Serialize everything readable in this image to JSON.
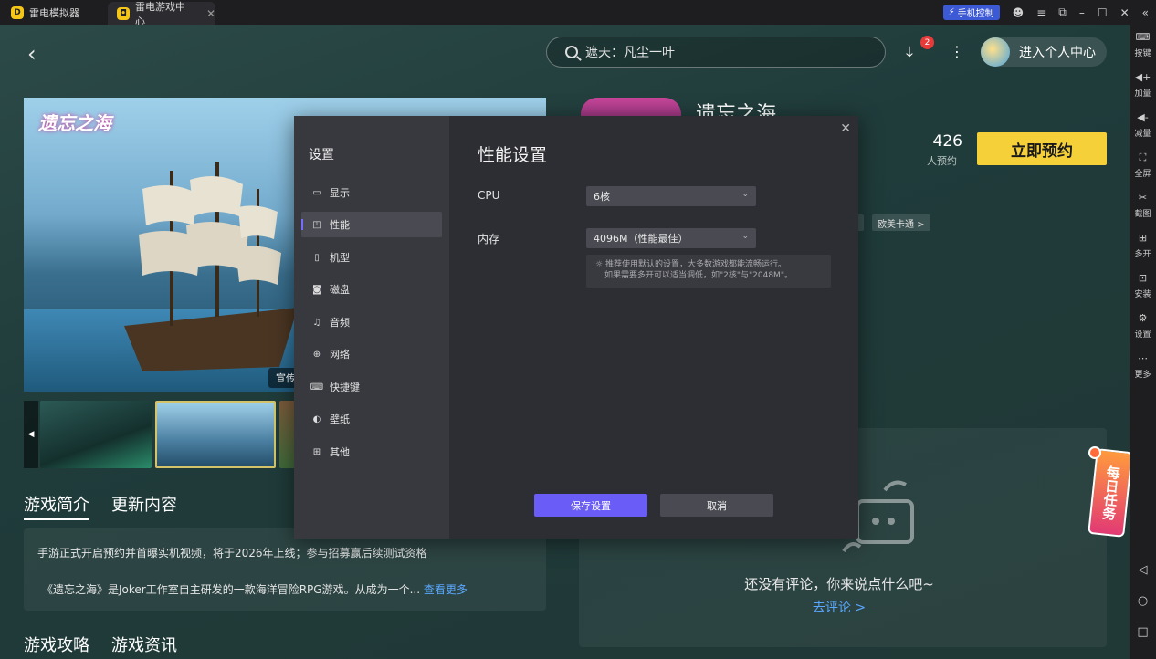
{
  "titlebar": {
    "tabs": [
      {
        "label": "雷电模拟器"
      },
      {
        "label": "雷电游戏中心"
      }
    ],
    "phone_control": "手机控制"
  },
  "sidebar": {
    "items": [
      {
        "label": "按键",
        "icon": "keyboard-icon"
      },
      {
        "label": "加量",
        "icon": "volume-up-icon"
      },
      {
        "label": "减量",
        "icon": "volume-down-icon"
      },
      {
        "label": "全屏",
        "icon": "fullscreen-icon"
      },
      {
        "label": "截图",
        "icon": "scissors-icon"
      },
      {
        "label": "多开",
        "icon": "multi-instance-icon"
      },
      {
        "label": "安装",
        "icon": "install-icon"
      },
      {
        "label": "设置",
        "icon": "gear-icon"
      },
      {
        "label": "更多",
        "icon": "more-icon"
      }
    ]
  },
  "header": {
    "search_text": "遮天：凡尘一叶",
    "download_badge": "2",
    "user_center": "进入个人中心"
  },
  "game": {
    "title": "遗忘之海",
    "reserve_count": "426",
    "reserve_label": "人预约",
    "reserve_button": "立即预约",
    "tag": "欧美卡通 >",
    "banner_label": "宣传片",
    "banner_logo": "遗忘之海"
  },
  "intro": {
    "tabs": [
      "游戏简介",
      "更新内容"
    ],
    "line1": "手游正式开启预约并首曝实机视频，将于2026年上线；参与招募赢后续测试资格",
    "line2": "《遗忘之海》是Joker工作室自主研发的一款海洋冒险RPG游戏。从成为一个...",
    "see_more": "查看更多"
  },
  "guide_tabs": [
    "游戏攻略",
    "游戏资讯"
  ],
  "comments": {
    "empty": "还没有评论，你来说点什么吧~",
    "go": "去评论 >"
  },
  "daily_task": "每日任务",
  "dialog": {
    "title": "设置",
    "nav": [
      {
        "label": "显示",
        "icon": "monitor-icon"
      },
      {
        "label": "性能",
        "icon": "performance-icon"
      },
      {
        "label": "机型",
        "icon": "phone-model-icon"
      },
      {
        "label": "磁盘",
        "icon": "disk-icon"
      },
      {
        "label": "音频",
        "icon": "audio-icon"
      },
      {
        "label": "网络",
        "icon": "globe-icon"
      },
      {
        "label": "快捷键",
        "icon": "shortcut-icon"
      },
      {
        "label": "壁纸",
        "icon": "palette-icon"
      },
      {
        "label": "其他",
        "icon": "grid-icon"
      }
    ],
    "active_nav": "性能",
    "section_title": "性能设置",
    "cpu_label": "CPU",
    "cpu_value": "6核",
    "memory_label": "内存",
    "memory_value": "4096M（性能最佳）",
    "hint_line1": "推荐使用默认的设置，大多数游戏都能流畅运行。",
    "hint_line2": "如果需要多开可以适当调低，如\"2核\"与\"2048M\"。",
    "save": "保存设置",
    "cancel": "取消"
  },
  "colors": {
    "accent": "#6a5cf6",
    "reserve": "#f5d038",
    "link": "#5aa7ff",
    "badge": "#e93a3a"
  }
}
